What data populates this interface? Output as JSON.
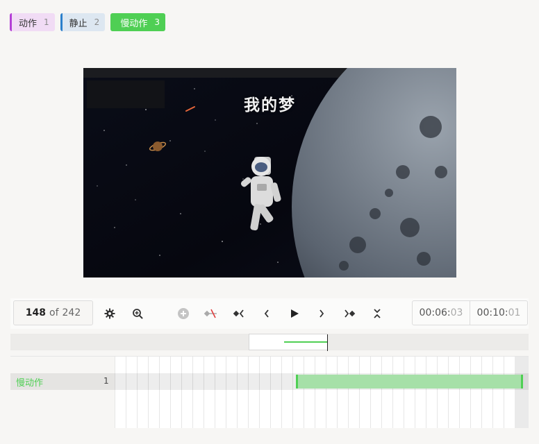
{
  "labels": [
    {
      "name": "动作",
      "count": "1",
      "color": "#b43fd6"
    },
    {
      "name": "静止",
      "count": "2",
      "color": "#2b7fcb"
    },
    {
      "name": "慢动作",
      "count": "3",
      "color": "#4fcf54"
    }
  ],
  "video": {
    "title": "我的梦"
  },
  "player": {
    "current_frame": "148",
    "of_text": "of",
    "total_frames": "242",
    "icons": [
      "gear-icon",
      "zoom-in-icon",
      "add-keyframe-icon",
      "remove-keyframe-icon",
      "prev-keyframe-icon",
      "prev-frame-icon",
      "play-icon",
      "next-frame-icon",
      "next-keyframe-icon",
      "collapse-icon"
    ],
    "current_time_main": "00:06:",
    "current_time_frames": "03",
    "duration_main": "00:10:",
    "duration_frames": "01"
  },
  "timeline": {
    "track_label": "慢动作",
    "track_count": "1",
    "segment_color": "#4fcf54"
  }
}
